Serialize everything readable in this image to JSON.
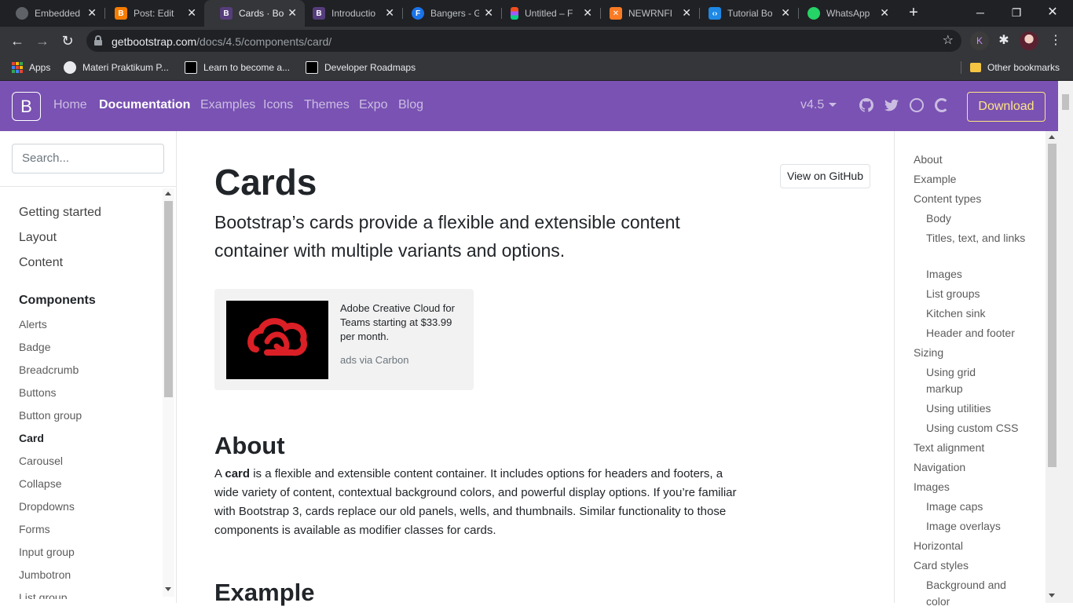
{
  "browser": {
    "tabs": [
      {
        "title": "Embedded",
        "icon": "chrome-icon",
        "color": "#5f6368"
      },
      {
        "title": "Post: Edit",
        "icon": "blogger-icon",
        "color": "#f57d00"
      },
      {
        "title": "Cards · Boo",
        "icon": "bootstrap-icon",
        "color": "#563d7c"
      },
      {
        "title": "Introductio",
        "icon": "bootstrap-icon",
        "color": "#563d7c"
      },
      {
        "title": "Bangers - G",
        "icon": "google-fonts-icon",
        "color": "#1a73e8"
      },
      {
        "title": "Untitled – F",
        "icon": "figma-icon",
        "color": "#f24e1e"
      },
      {
        "title": "NEWRNFI",
        "icon": "xampp-icon",
        "color": "#fb7a24"
      },
      {
        "title": "Tutorial Bo",
        "icon": "tutorial-icon",
        "color": "#1e88e5"
      },
      {
        "title": "WhatsApp",
        "icon": "whatsapp-icon",
        "color": "#25d366"
      }
    ],
    "url_host": "getbootstrap.com",
    "url_path": "/docs/4.5/components/card/",
    "bookmarks": [
      {
        "label": "Apps"
      },
      {
        "label": "Materi Praktikum P..."
      },
      {
        "label": "Learn to become a..."
      },
      {
        "label": "Developer Roadmaps"
      }
    ],
    "other_bookmarks": "Other bookmarks"
  },
  "navbar": {
    "brand": "B",
    "links": [
      "Home",
      "Documentation",
      "Examples",
      "Icons",
      "Themes",
      "Expo",
      "Blog"
    ],
    "active_link": "Documentation",
    "version": "v4.5",
    "download": "Download",
    "accent_color": "#7952b3",
    "download_color": "#ffe484"
  },
  "sidebar": {
    "search_placeholder": "Search...",
    "groups": [
      "Getting started",
      "Layout",
      "Content"
    ],
    "components_heading": "Components",
    "items": [
      "Alerts",
      "Badge",
      "Breadcrumb",
      "Buttons",
      "Button group",
      "Card",
      "Carousel",
      "Collapse",
      "Dropdowns",
      "Forms",
      "Input group",
      "Jumbotron",
      "List group"
    ],
    "active_item": "Card"
  },
  "main": {
    "title": "Cards",
    "view_on_github": "View on GitHub",
    "lead": "Bootstrap’s cards provide a flexible and extensible content container with multiple variants and options.",
    "ad": {
      "text": "Adobe Creative Cloud for Teams starting at $33.99 per month.",
      "powered_by": "ads via Carbon"
    },
    "about_heading": "About",
    "about_para_prefix": "A ",
    "about_para_bold": "card",
    "about_para_rest": " is a flexible and extensible content container. It includes options for headers and footers, a wide variety of content, contextual background colors, and powerful display options. If you’re familiar with Bootstrap 3, cards replace our old panels, wells, and thumbnails. Similar functionality to those components is available as modifier classes for cards.",
    "example_heading": "Example"
  },
  "toc": {
    "items": [
      {
        "label": "About",
        "level": 1
      },
      {
        "label": "Example",
        "level": 1
      },
      {
        "label": "Content types",
        "level": 1
      },
      {
        "label": "Body",
        "level": 2
      },
      {
        "label": "Titles, text, and links",
        "level": 2
      },
      {
        "label": "Images",
        "level": 2
      },
      {
        "label": "List groups",
        "level": 2
      },
      {
        "label": "Kitchen sink",
        "level": 2
      },
      {
        "label": "Header and footer",
        "level": 2
      },
      {
        "label": "Sizing",
        "level": 1
      },
      {
        "label": "Using grid markup",
        "level": 2
      },
      {
        "label": "Using utilities",
        "level": 2
      },
      {
        "label": "Using custom CSS",
        "level": 2
      },
      {
        "label": "Text alignment",
        "level": 1
      },
      {
        "label": "Navigation",
        "level": 1
      },
      {
        "label": "Images",
        "level": 1
      },
      {
        "label": "Image caps",
        "level": 2
      },
      {
        "label": "Image overlays",
        "level": 2
      },
      {
        "label": "Horizontal",
        "level": 1
      },
      {
        "label": "Card styles",
        "level": 1
      },
      {
        "label": "Background and color",
        "level": 2
      }
    ]
  }
}
